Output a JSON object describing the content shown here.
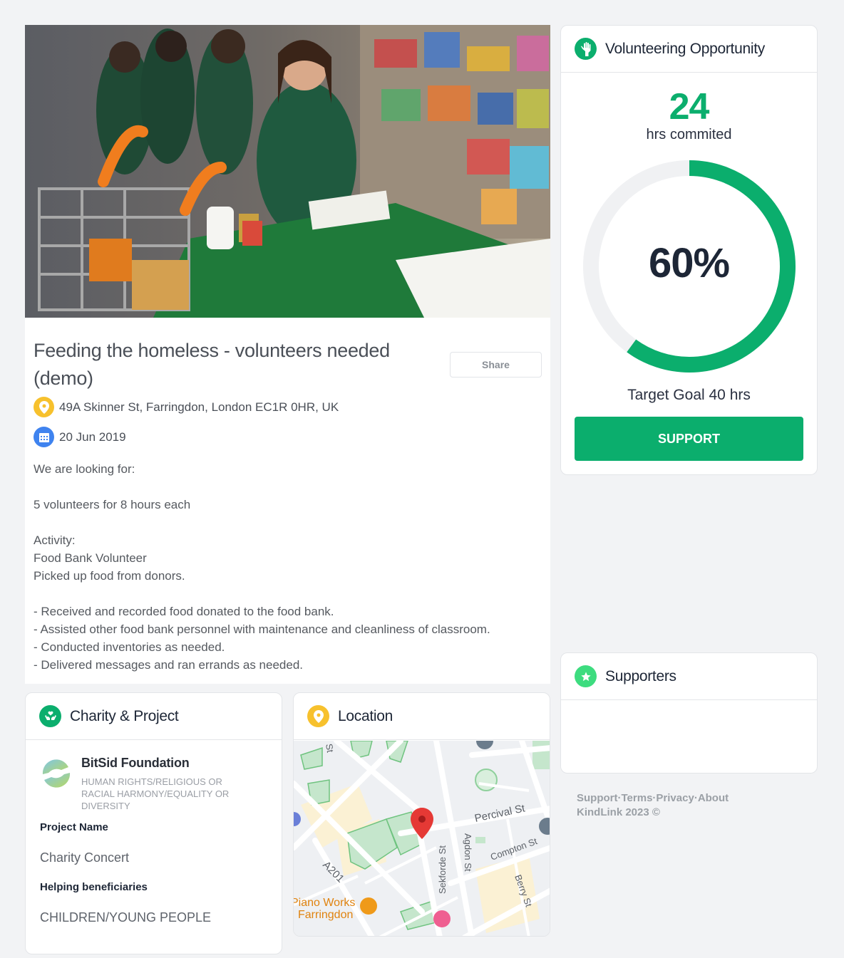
{
  "opportunity": {
    "title": "Feeding the homeless - volunteers needed (demo)",
    "share_label": "Share",
    "address": "49A Skinner St, Farringdon, London EC1R 0HR, UK",
    "date": "20 Jun 2019",
    "description": [
      "We are looking for:",
      "",
      "5 volunteers for 8 hours each",
      "",
      "Activity:",
      "Food Bank Volunteer",
      "Picked up food from donors.",
      "",
      "- Received and recorded food donated to the food bank.",
      "- Assisted other food bank personnel with maintenance and cleanliness of classroom.",
      "- Conducted inventories as needed.",
      "- Delivered messages and ran errands as needed."
    ]
  },
  "volunteering": {
    "header": "Volunteering Opportunity",
    "hours_committed": "24",
    "hours_label": "hrs commited",
    "progress_percent": 60,
    "progress_label": "60%",
    "goal_label": "Target Goal 40 hrs",
    "support_label": "SUPPORT"
  },
  "supporters": {
    "header": "Supporters"
  },
  "footer": {
    "links": [
      "Support",
      "Terms",
      "Privacy",
      "About"
    ],
    "separator": "·",
    "copyright": "KindLink 2023 ©"
  },
  "charity": {
    "header": "Charity & Project",
    "org_name": "BitSid Foundation",
    "org_category": "HUMAN RIGHTS/RELIGIOUS OR RACIAL HARMONY/EQUALITY OR DIVERSITY",
    "project_name_label": "Project Name",
    "project_name": "Charity Concert",
    "beneficiaries_label": "Helping beneficiaries",
    "beneficiaries": "CHILDREN/YOUNG PEOPLE"
  },
  "location": {
    "header": "Location",
    "map_labels": {
      "percival": "Percival St",
      "agdon": "Agdon St",
      "compton": "Compton St",
      "sekforde": "Sekforde St",
      "berry": "Berry St",
      "a201": "A201",
      "piano_line1": "Piano Works",
      "piano_line2": "Farringdon",
      "st": "St"
    }
  },
  "colors": {
    "accent": "#0bae6d",
    "ring_track": "#f0f1f3",
    "pin": "#e53935"
  }
}
